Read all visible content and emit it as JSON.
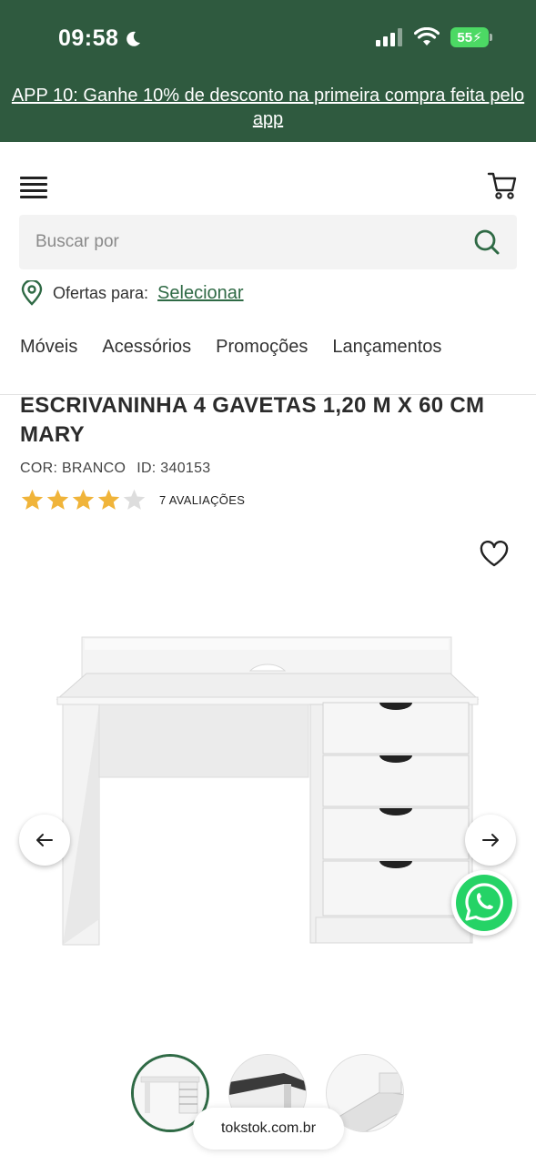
{
  "status_bar": {
    "time": "09:58",
    "battery": "55"
  },
  "promo": {
    "text": "APP 10: Ganhe 10% de desconto na primeira compra feita pelo app"
  },
  "header": {
    "search_placeholder": "Buscar por",
    "offers_label": "Ofertas para:",
    "offers_link": "Selecionar",
    "nav": [
      "Móveis",
      "Acessórios",
      "Promoções",
      "Lançamentos"
    ]
  },
  "product": {
    "title": "ESCRIVANINHA 4 GAVETAS 1,20 M X 60 CM MARY",
    "color": "COR: BRANCO",
    "id": "ID: 340153",
    "rating": 4,
    "rating_max": 5,
    "reviews": "7 AVALIAÇÕES"
  },
  "browser": {
    "url": "tokstok.com.br"
  },
  "colors": {
    "brand_green": "#2f5a3f",
    "link_green": "#2f6a45",
    "star": "#f0b43a",
    "star_empty": "#dddddd",
    "whatsapp": "#25d366"
  },
  "icons": [
    "moon-icon",
    "signal-icon",
    "wifi-icon",
    "menu-icon",
    "cart-icon",
    "search-icon",
    "location-pin-icon",
    "star-icon",
    "heart-icon",
    "arrow-left-icon",
    "arrow-right-icon",
    "whatsapp-icon"
  ]
}
